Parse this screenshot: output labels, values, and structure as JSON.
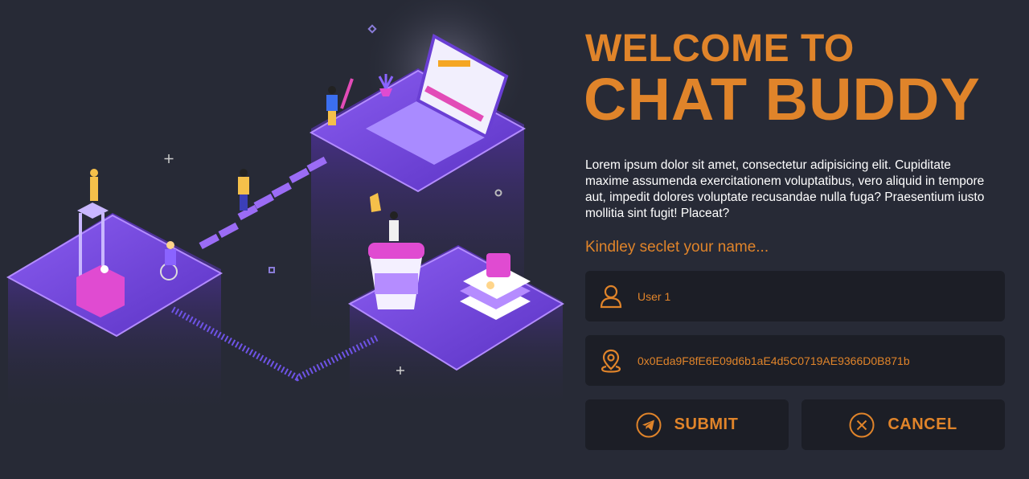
{
  "welcome": {
    "line1": "WELCOME TO",
    "line2": "CHAT BUDDY"
  },
  "description": "Lorem ipsum dolor sit amet, consectetur adipisicing elit. Cupiditate maxime assumenda exercitationem voluptatibus, vero aliquid in tempore aut, impedit dolores voluptate recusandae nulla fuga? Praesentium iusto mollitia sint fugit! Placeat?",
  "prompt": "Kindley seclet your name...",
  "form": {
    "name_value": "User 1",
    "address_value": "0x0Eda9F8fE6E09d6b1aE4d5C0719AE9366D0B871b",
    "name_icon": "user-icon",
    "address_icon": "location-pin-icon"
  },
  "buttons": {
    "submit_label": "SUBMIT",
    "submit_icon": "telegram-send-icon",
    "cancel_label": "CANCEL",
    "cancel_icon": "close-circle-icon"
  },
  "colors": {
    "background": "#272a36",
    "accent": "#e0842a",
    "field_bg": "#1c1e26",
    "illustration_purple": "#6a3fd4"
  }
}
